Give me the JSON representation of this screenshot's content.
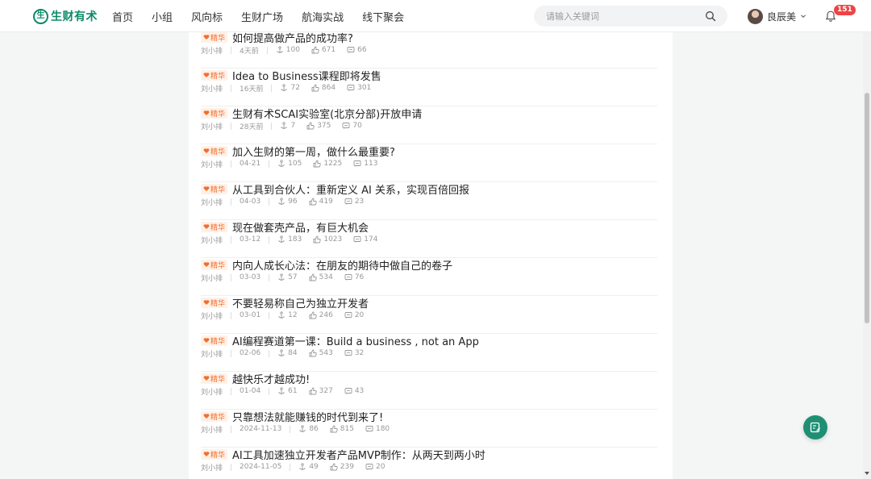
{
  "header": {
    "logo_mark": "生",
    "logo_text": "生财有术",
    "nav": [
      "首页",
      "小组",
      "风向标",
      "生财广场",
      "航海实战",
      "线下聚会"
    ],
    "search_placeholder": "请输入关键词",
    "user_name": "良辰美",
    "notification_count": "151"
  },
  "colors": {
    "brand": "#0d8a6a",
    "tag_bg": "#fff1e8",
    "tag_text": "#f06f2f",
    "badge": "#f04343",
    "fab": "#1e8f73"
  },
  "tag_label": "精华",
  "posts": [
    {
      "title": "如何提高做产品的成功率?",
      "author": "刘小排",
      "time": "4天前",
      "shares": "100",
      "likes": "671",
      "comments": "66"
    },
    {
      "title": "Idea to Business课程即将发售",
      "author": "刘小排",
      "time": "16天前",
      "shares": "72",
      "likes": "864",
      "comments": "301"
    },
    {
      "title": "生财有术SCAI实验室(北京分部)开放申请",
      "author": "刘小排",
      "time": "28天前",
      "shares": "7",
      "likes": "375",
      "comments": "70"
    },
    {
      "title": "加入生财的第一周，做什么最重要?",
      "author": "刘小排",
      "time": "04-21",
      "shares": "105",
      "likes": "1225",
      "comments": "113"
    },
    {
      "title": "从工具到合伙人：重新定义 AI 关系，实现百倍回报",
      "author": "刘小排",
      "time": "04-03",
      "shares": "96",
      "likes": "419",
      "comments": "23"
    },
    {
      "title": "现在做套壳产品，有巨大机会",
      "author": "刘小排",
      "time": "03-12",
      "shares": "183",
      "likes": "1023",
      "comments": "174"
    },
    {
      "title": "内向人成长心法：在朋友的期待中做自己的卷子",
      "author": "刘小排",
      "time": "03-03",
      "shares": "57",
      "likes": "534",
      "comments": "76"
    },
    {
      "title": "不要轻易称自己为独立开发者",
      "author": "刘小排",
      "time": "03-01",
      "shares": "12",
      "likes": "246",
      "comments": "20"
    },
    {
      "title": "AI编程赛道第一课：Build a business , not an App",
      "author": "刘小排",
      "time": "02-06",
      "shares": "84",
      "likes": "543",
      "comments": "32"
    },
    {
      "title": "越快乐才越成功!",
      "author": "刘小排",
      "time": "01-04",
      "shares": "61",
      "likes": "327",
      "comments": "43"
    },
    {
      "title": "只靠想法就能赚钱的时代到来了!",
      "author": "刘小排",
      "time": "2024-11-13",
      "shares": "86",
      "likes": "815",
      "comments": "180"
    },
    {
      "title": "AI工具加速独立开发者产品MVP制作：从两天到两小时",
      "author": "刘小排",
      "time": "2024-11-05",
      "shares": "49",
      "likes": "239",
      "comments": "20"
    }
  ],
  "icons": {
    "search": "search-icon",
    "bell": "bell-icon",
    "chevron": "chevron-down-icon",
    "share": "anchor-icon",
    "like": "thumb-up-icon",
    "comment": "comment-icon",
    "fab": "edit-icon",
    "tag": "heart-icon"
  }
}
